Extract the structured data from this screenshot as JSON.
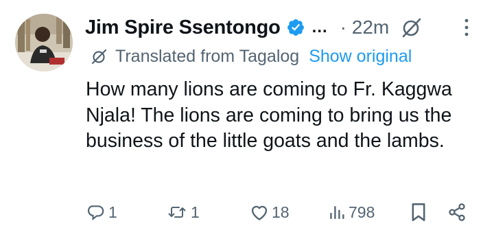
{
  "tweet": {
    "author_name": "Jim Spire Ssentongo",
    "name_truncation": "...",
    "timestamp": "· 22m",
    "translation": {
      "note": "Translated from Tagalog",
      "show_original": "Show original"
    },
    "text": "How many lions are coming to Fr. Kaggwa Njala! The lions are coming to bring us the business of the little goats and the lambs.",
    "actions": {
      "replies": "1",
      "retweets": "1",
      "likes": "18",
      "views": "798"
    },
    "icons": {
      "verified": "verified-badge-icon",
      "grok": "grok-icon",
      "more": "more-vertical-icon",
      "reply": "reply-icon",
      "retweet": "retweet-icon",
      "like": "heart-icon",
      "views": "views-icon",
      "bookmark": "bookmark-icon",
      "share": "share-icon"
    },
    "colors": {
      "accent": "#1d9bf0",
      "secondary_text": "#536471",
      "primary_text": "#0f1419"
    }
  }
}
